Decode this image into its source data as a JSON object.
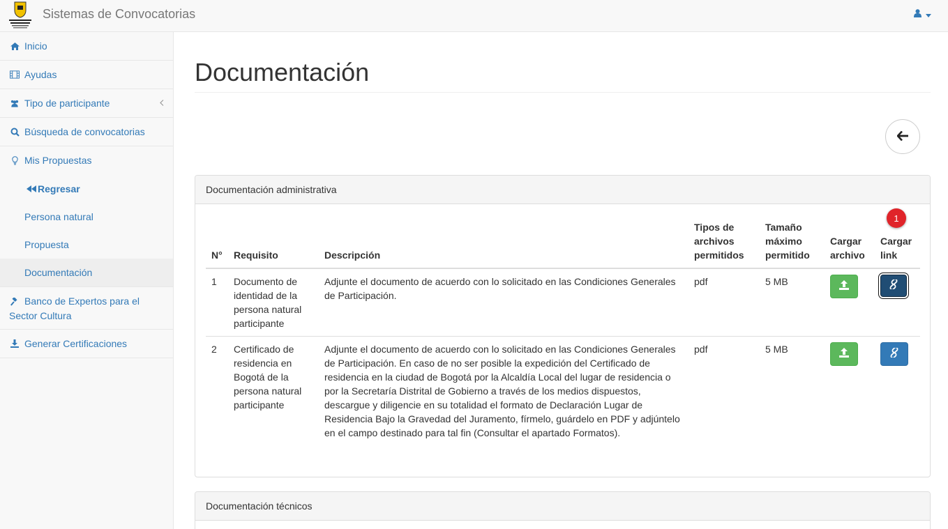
{
  "navbar": {
    "brand": "Sistemas de Convocatorias",
    "logo_icon": "bogota-coat-of-arms-logo",
    "user_icon": "user-icon"
  },
  "sidebar": {
    "items": [
      {
        "label": "Inicio",
        "icon": "home-icon"
      },
      {
        "label": "Ayudas",
        "icon": "film-icon"
      },
      {
        "label": "Tipo de participante",
        "icon": "users-icon"
      },
      {
        "label": "Búsqueda de convocatorias",
        "icon": "search-icon"
      },
      {
        "label": "Mis Propuestas",
        "icon": "lightbulb-icon"
      },
      {
        "label": "Regresar",
        "icon": "backward-icon"
      },
      {
        "label": "Persona natural"
      },
      {
        "label": "Propuesta"
      },
      {
        "label": "Documentación"
      },
      {
        "label": "Banco de Expertos para el Sector Cultura",
        "icon": "gavel-icon"
      },
      {
        "label": "Generar Certificaciones",
        "icon": "download-icon"
      }
    ]
  },
  "main": {
    "title": "Documentación",
    "back_icon": "arrow-left-icon",
    "panel_admin": {
      "heading": "Documentación administrativa",
      "headers": {
        "n": "N°",
        "requisito": "Requisito",
        "descripcion": "Descripción",
        "tipos": "Tipos de archivos permitidos",
        "tamano": "Tamaño máximo permitido",
        "cargar_archivo": "Cargar archivo",
        "cargar_link": "Cargar link"
      },
      "rows": [
        {
          "n": "1",
          "requisito": "Documento de identidad de la persona natural participante",
          "descripcion": "Adjunte el documento de acuerdo con lo solicitado en las Condiciones Generales de Participación.",
          "tipos": "pdf",
          "tamano": "5 MB"
        },
        {
          "n": "2",
          "requisito": "Certificado de residencia en Bogotá de la persona natural participante",
          "descripcion": "Adjunte el documento de acuerdo con lo solicitado en las Condiciones Generales de Participación. En caso de no ser posible la expedición del Certificado de residencia en la ciudad de Bogotá por la Alcaldía Local del lugar de residencia o por la Secretaría Distrital de Gobierno a través de los medios dispuestos, descargue y diligencie en su totalidad el formato de Declaración Lugar de Residencia Bajo la Gravedad del Juramento, fírmelo, guárdelo en PDF y adjúntelo en el campo destinado para tal fin (Consultar el apartado Formatos).",
          "tipos": "pdf",
          "tamano": "5 MB"
        }
      ],
      "badge": "1"
    },
    "panel_tecnicos": {
      "heading": "Documentación técnicos"
    }
  },
  "colors": {
    "link": "#337ab7",
    "success": "#5cb85c",
    "primary": "#337ab7",
    "badge": "#e0242a"
  }
}
